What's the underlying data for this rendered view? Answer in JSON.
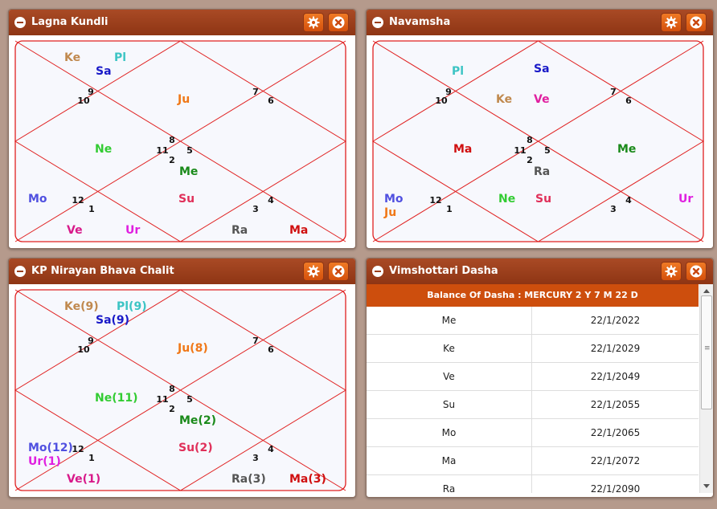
{
  "charts": [
    {
      "id": "lagna",
      "title": "Lagna Kundli",
      "house_numbers": [
        "9",
        "10",
        "7",
        "6",
        "8",
        "11",
        "5",
        "2",
        "12",
        "1",
        "3",
        "4"
      ],
      "planets": [
        {
          "t": "Ke",
          "c": "#c0894e"
        },
        {
          "t": "Pl",
          "c": "#3cc4c4"
        },
        {
          "t": "Sa",
          "c": "#1a1ac8"
        },
        {
          "t": "Ju",
          "c": "#f07818"
        },
        {
          "t": "Ne",
          "c": "#33cc33"
        },
        {
          "t": "Me",
          "c": "#1a8a1a"
        },
        {
          "t": "Mo",
          "c": "#5050e0"
        },
        {
          "t": "Su",
          "c": "#e0305a"
        },
        {
          "t": "Ve",
          "c": "#d81a8a"
        },
        {
          "t": "Ur",
          "c": "#e020e0"
        },
        {
          "t": "Ra",
          "c": "#555555"
        },
        {
          "t": "Ma",
          "c": "#d01010"
        }
      ]
    },
    {
      "id": "navamsha",
      "title": "Navamsha",
      "house_numbers": [
        "9",
        "10",
        "7",
        "6",
        "8",
        "11",
        "5",
        "2",
        "12",
        "1",
        "3",
        "4"
      ],
      "planets": [
        {
          "t": "Pl",
          "c": "#3cc4c4"
        },
        {
          "t": "Sa",
          "c": "#1a1ac8"
        },
        {
          "t": "Ke",
          "c": "#c0894e"
        },
        {
          "t": "Ve",
          "c": "#e020a0"
        },
        {
          "t": "Ma",
          "c": "#d01010"
        },
        {
          "t": "Me",
          "c": "#1a8a1a"
        },
        {
          "t": "Ra",
          "c": "#555555"
        },
        {
          "t": "Mo",
          "c": "#5050e0"
        },
        {
          "t": "Ju",
          "c": "#f07818"
        },
        {
          "t": "Ne",
          "c": "#33cc33"
        },
        {
          "t": "Su",
          "c": "#e0305a"
        },
        {
          "t": "Ur",
          "c": "#e020e0"
        }
      ]
    },
    {
      "id": "kp",
      "title": "KP Nirayan Bhava Chalit",
      "house_numbers": [
        "9",
        "10",
        "7",
        "6",
        "8",
        "11",
        "5",
        "2",
        "12",
        "1",
        "3",
        "4"
      ],
      "planets": [
        {
          "t": "Ke(9)",
          "c": "#c0894e"
        },
        {
          "t": "Pl(9)",
          "c": "#3cc4c4"
        },
        {
          "t": "Sa(9)",
          "c": "#1a1ac8"
        },
        {
          "t": "Ju(8)",
          "c": "#f07818"
        },
        {
          "t": "Ne(11)",
          "c": "#33cc33"
        },
        {
          "t": "Me(2)",
          "c": "#1a8a1a"
        },
        {
          "t": "Mo(12)",
          "c": "#5050e0"
        },
        {
          "t": "Ur(1)",
          "c": "#e020e0"
        },
        {
          "t": "Su(2)",
          "c": "#e0305a"
        },
        {
          "t": "Ve(1)",
          "c": "#d81a8a"
        },
        {
          "t": "Ra(3)",
          "c": "#555555"
        },
        {
          "t": "Ma(3)",
          "c": "#d01010"
        }
      ]
    }
  ],
  "dasha": {
    "title": "Vimshottari Dasha",
    "balance": "Balance Of Dasha : MERCURY 2 Y 7 M 22 D",
    "rows": [
      [
        "Me",
        "22/1/2022"
      ],
      [
        "Ke",
        "22/1/2029"
      ],
      [
        "Ve",
        "22/1/2049"
      ],
      [
        "Su",
        "22/1/2055"
      ],
      [
        "Mo",
        "22/1/2065"
      ],
      [
        "Ma",
        "22/1/2072"
      ],
      [
        "Ra",
        "22/1/2090"
      ]
    ]
  },
  "icons": {
    "gear": "gear-icon",
    "close": "close-icon",
    "collapse": "collapse-icon"
  },
  "colors": {
    "header": "#9b3f1b",
    "button": "#e8651a",
    "chart_line": "#e02020",
    "chart_bg": "#f7f8fd"
  }
}
